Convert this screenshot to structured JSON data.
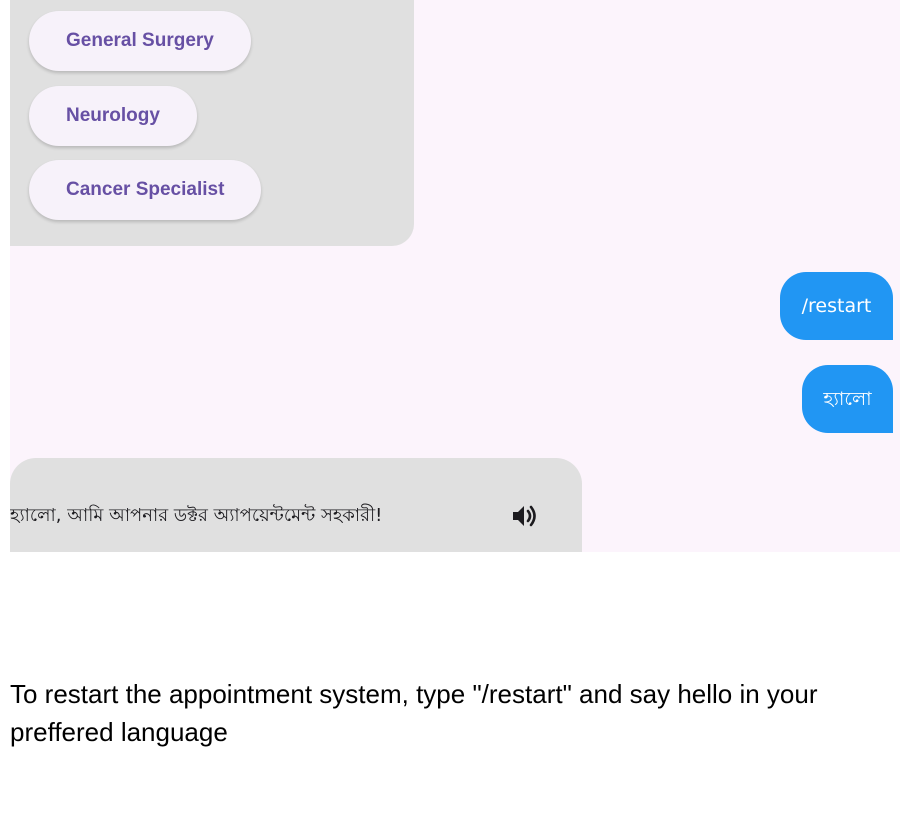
{
  "chat": {
    "options": [
      {
        "label": "General Surgery"
      },
      {
        "label": "Neurology"
      },
      {
        "label": "Cancer Specialist"
      }
    ],
    "user_messages": [
      {
        "text": "/restart"
      },
      {
        "text": "হ্যালো"
      }
    ],
    "bot_message": {
      "text": "হ্যালো, আমি আপনার ডক্টর অ্যাপয়েন্টমেন্ট সহকারী!",
      "icon": "speaker-icon"
    }
  },
  "footer": {
    "instruction": "To restart the appointment system, type \"/restart\" and say hello in your preffered language"
  },
  "colors": {
    "chat_background": "#fcf4fc",
    "bot_bubble": "#e0e0e0",
    "user_bubble": "#2196f3",
    "chip_text": "#6750a4"
  }
}
